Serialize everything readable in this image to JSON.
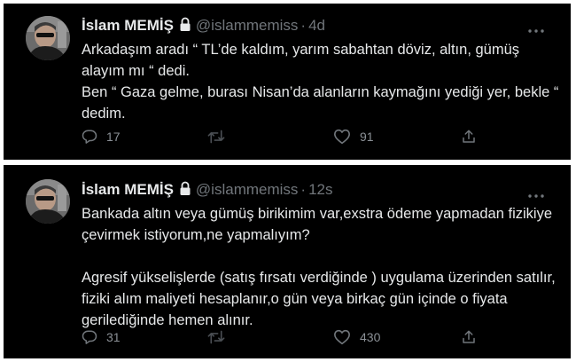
{
  "colors": {
    "background": "#ffffff",
    "card": "#000000",
    "primary_text": "#e7e9ea",
    "secondary_text": "#71767b"
  },
  "tweets": [
    {
      "author": {
        "name": "İslam MEMİŞ",
        "handle": "@islammemiss",
        "protected_icon": "lock-icon",
        "avatar": "avatar"
      },
      "separator": "·",
      "time": "4d",
      "lines": [
        "Arkadaşım aradı “ TL’de kaldım, yarım sabahtan döviz, altın, gümüş alayım mı “ dedi.",
        "Ben “ Gaza gelme, burası Nisan’da alanların kaymağını yediği yer, bekle “ dedim."
      ],
      "actions": {
        "reply": {
          "icon": "reply-icon",
          "count": "17"
        },
        "retweet": {
          "icon": "retweet-icon",
          "count": ""
        },
        "like": {
          "icon": "heart-icon",
          "count": "91"
        },
        "share": {
          "icon": "share-icon",
          "count": ""
        }
      }
    },
    {
      "author": {
        "name": "İslam MEMİŞ",
        "handle": "@islammemiss",
        "protected_icon": "lock-icon",
        "avatar": "avatar"
      },
      "separator": "·",
      "time": "12s",
      "lines": [
        "Bankada altın veya gümüş birikimim var,exstra ödeme yapmadan fizikiye çevirmek istiyorum,ne yapmalıyım?",
        "Agresif yükselişlerde (satış fırsatı verdiğinde ) uygulama üzerinden satılır, fiziki alım maliyeti hesaplanır,o gün veya birkaç gün içinde o fiyata gerilediğinde hemen alınır."
      ],
      "actions": {
        "reply": {
          "icon": "reply-icon",
          "count": "31"
        },
        "retweet": {
          "icon": "retweet-icon",
          "count": ""
        },
        "like": {
          "icon": "heart-icon",
          "count": "430"
        },
        "share": {
          "icon": "share-icon",
          "count": ""
        }
      }
    }
  ]
}
